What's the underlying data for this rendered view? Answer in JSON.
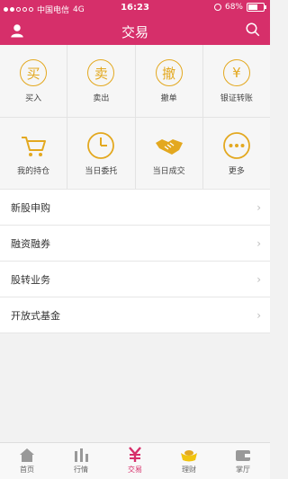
{
  "status_bar": {
    "carrier": "中国电信",
    "network": "4G",
    "time": "16:23",
    "battery_percent": "68%",
    "battery_level": 0.68
  },
  "header": {
    "title": "交易",
    "icons": [
      "user-icon",
      "search-icon"
    ]
  },
  "grid": {
    "items": [
      {
        "label": "买入",
        "glyph": "买"
      },
      {
        "label": "卖出",
        "glyph": "卖"
      },
      {
        "label": "撤单",
        "glyph": "撤"
      },
      {
        "label": "银证转账",
        "glyph": "¥"
      },
      {
        "label": "我的持仓",
        "icon": "cart-icon"
      },
      {
        "label": "当日委托",
        "icon": "clock-icon"
      },
      {
        "label": "当日成交",
        "icon": "handshake-icon"
      },
      {
        "label": "更多",
        "icon": "more-icon"
      }
    ]
  },
  "list": {
    "items": [
      {
        "label": "新股申购"
      },
      {
        "label": "融资融券"
      },
      {
        "label": "股转业务"
      },
      {
        "label": "开放式基金"
      }
    ]
  },
  "tabbar": {
    "items": [
      {
        "label": "首页",
        "icon": "home-icon"
      },
      {
        "label": "行情",
        "icon": "bars-icon"
      },
      {
        "label": "交易",
        "icon": "yen-icon",
        "active": true
      },
      {
        "label": "理财",
        "icon": "gold-ingot-icon"
      },
      {
        "label": "掌厅",
        "icon": "wallet-icon"
      }
    ]
  },
  "colors": {
    "primary": "#d62f6a",
    "icon_accent": "#e3a81f",
    "ingot": "#f1c40f"
  }
}
